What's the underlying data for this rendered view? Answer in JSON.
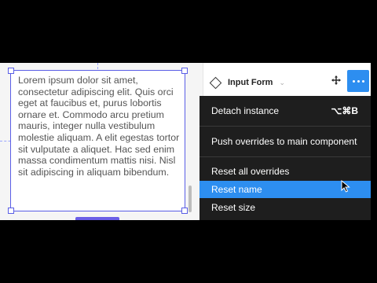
{
  "canvas": {
    "text_content": "Lorem ipsum dolor sit amet, consectetur adipiscing elit. Quis orci eget at faucibus et, purus lobortis ornare et. Commodo arcu pretium mauris, integer nulla vestibulum molestie aliquam. A elit egestas tortor sit vulputate a aliquet. Hac sed enim massa condimentum mattis nisi. Nisl sit adipiscing in aliquam bibendum."
  },
  "panel": {
    "component_name": "Input Form",
    "chevron": "⌄",
    "move_icon": "move-icon",
    "more_icon": "more-options-icon",
    "accent": "#2d8ef0"
  },
  "menu": {
    "detach_label": "Detach instance",
    "detach_shortcut": "⌥⌘B",
    "push_label": "Push overrides to main component",
    "reset_all_label": "Reset all overrides",
    "reset_name_label": "Reset name",
    "reset_size_label": "Reset size"
  }
}
